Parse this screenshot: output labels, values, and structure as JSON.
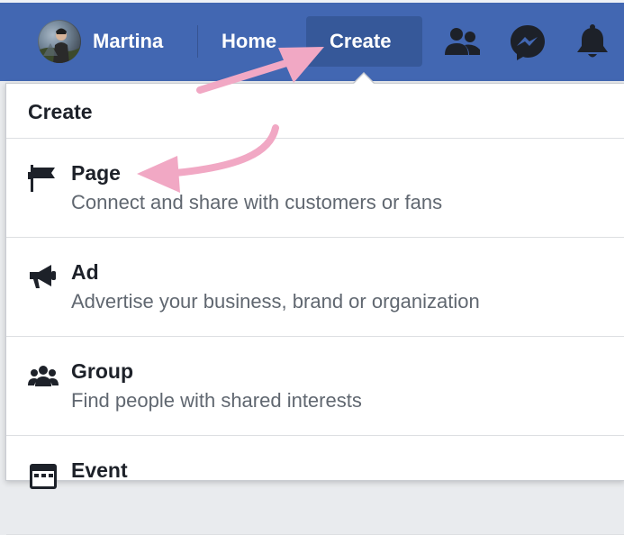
{
  "topbar": {
    "user_name": "Martina",
    "home_label": "Home",
    "create_label": "Create",
    "icons": {
      "friends": "friend-requests-icon",
      "messenger": "messenger-icon",
      "notifications": "bell-icon"
    },
    "colors": {
      "bar": "#4267b2",
      "active_tab": "#365899"
    }
  },
  "dropdown": {
    "header": "Create",
    "items": [
      {
        "title": "Page",
        "description": "Connect and share with customers or fans",
        "icon": "flag-icon"
      },
      {
        "title": "Ad",
        "description": "Advertise your business, brand or organization",
        "icon": "megaphone-icon"
      },
      {
        "title": "Group",
        "description": "Find people with shared interests",
        "icon": "group-icon"
      },
      {
        "title": "Event",
        "description": "",
        "icon": "calendar-icon"
      }
    ]
  },
  "annotations": {
    "arrow_color": "#f1a8c4"
  }
}
